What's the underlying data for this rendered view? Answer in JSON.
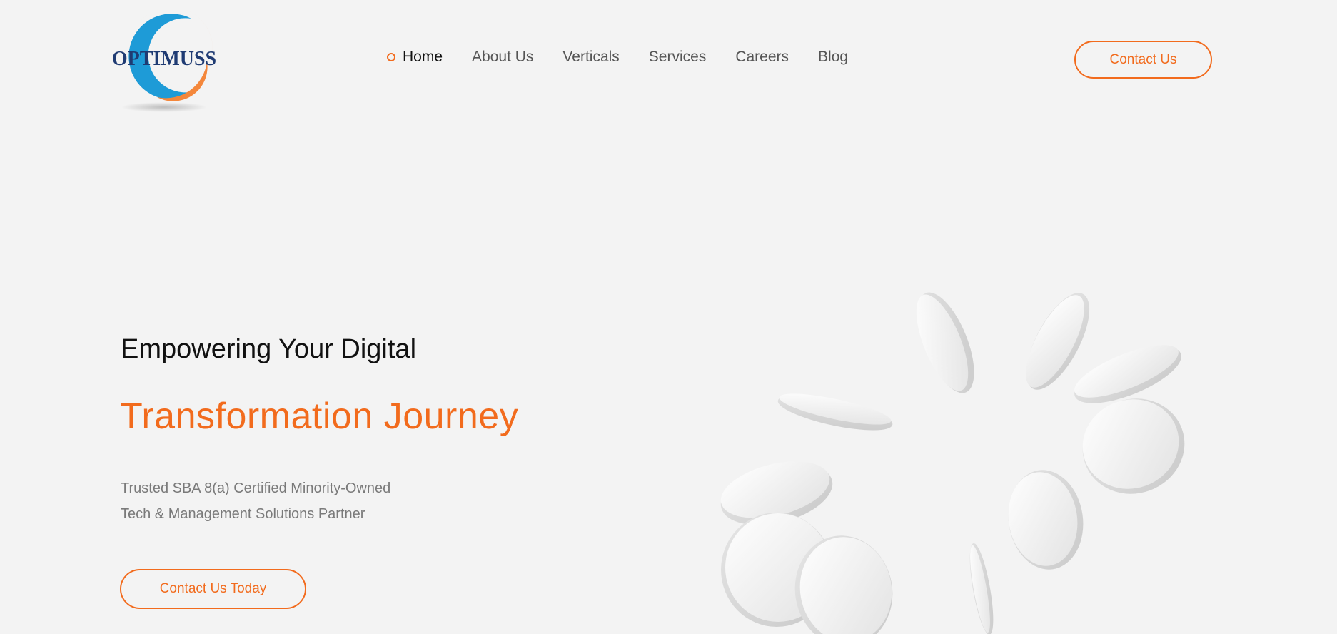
{
  "brand": {
    "name": "OPTIMUSS",
    "accent_color": "#f26b1d",
    "logo_blue": "#1e9bd7",
    "logo_orange": "#f4873b",
    "logo_text_color": "#1f3b73"
  },
  "nav": {
    "items": [
      {
        "label": "Home",
        "active": true
      },
      {
        "label": "About Us",
        "active": false
      },
      {
        "label": "Verticals",
        "active": false
      },
      {
        "label": "Services",
        "active": false
      },
      {
        "label": "Careers",
        "active": false
      },
      {
        "label": "Blog",
        "active": false
      }
    ],
    "cta_label": "Contact Us"
  },
  "hero": {
    "line1": "Empowering Your Digital",
    "line2": "Transformation Journey",
    "subtitle": [
      "Trusted SBA 8(a) Certified Minority-Owned",
      "Tech & Management Solutions Partner"
    ],
    "cta_label": "Contact Us Today"
  }
}
